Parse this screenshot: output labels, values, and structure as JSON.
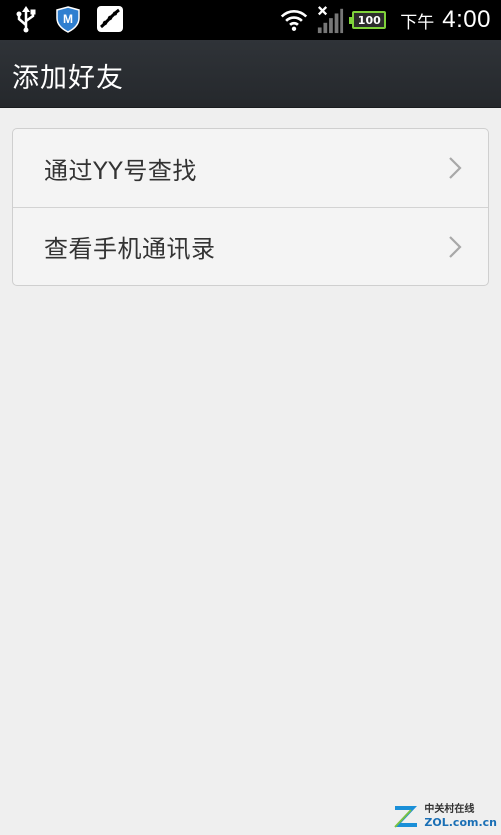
{
  "status_bar": {
    "icons_left": [
      "usb-icon",
      "shield-m-icon",
      "pea-app-icon"
    ],
    "icons_right": [
      "wifi-icon",
      "signal-icon",
      "battery-icon"
    ],
    "battery_level": "100",
    "time_prefix": "下午",
    "time": "4:00"
  },
  "title_bar": {
    "title": "添加好友"
  },
  "list": {
    "items": [
      {
        "label": "通过YY号查找",
        "icon": "chevron-right-icon"
      },
      {
        "label": "查看手机通讯录",
        "icon": "chevron-right-icon"
      }
    ]
  },
  "watermark": {
    "cn": "中关村在线",
    "en": "ZOL.com.cn"
  },
  "colors": {
    "status_bar_bg": "#000000",
    "title_bar_bg": "#2a2d31",
    "page_bg": "#efefef",
    "battery_green": "#7fd23a",
    "text_dark": "#333333"
  }
}
